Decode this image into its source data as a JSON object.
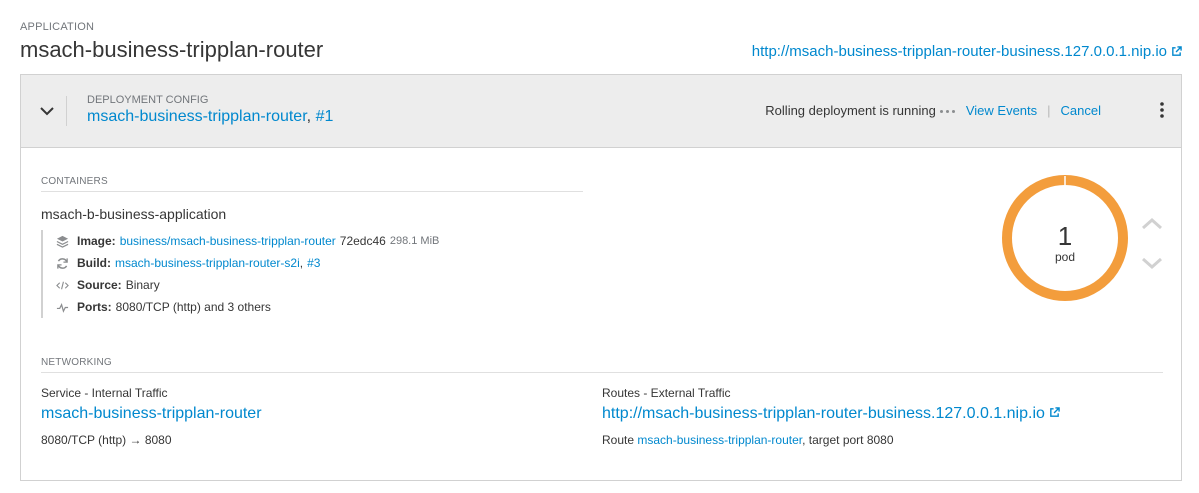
{
  "application": {
    "label": "APPLICATION",
    "name": "msach-business-tripplan-router",
    "route_url": "http://msach-business-tripplan-router-business.127.0.0.1.nip.io"
  },
  "deployment": {
    "label": "DEPLOYMENT CONFIG",
    "name": "msach-business-tripplan-router",
    "separator": ",",
    "revision": "#1",
    "status_text": "Rolling deployment is running",
    "view_events": "View Events",
    "divider": "|",
    "cancel": "Cancel"
  },
  "containers": {
    "label": "CONTAINERS",
    "name": "msach-b-business-application",
    "image": {
      "key": "Image:",
      "link": "business/msach-business-tripplan-router",
      "hash": "72edc46",
      "size": "298.1 MiB"
    },
    "build": {
      "key": "Build:",
      "link": "msach-business-tripplan-router-s2i",
      "separator": ",",
      "number": "#3"
    },
    "source": {
      "key": "Source:",
      "value": "Binary"
    },
    "ports": {
      "key": "Ports:",
      "value": "8080/TCP (http) and 3 others"
    }
  },
  "pods": {
    "count": "1",
    "unit": "pod",
    "ring_color": "#f39d3c"
  },
  "networking": {
    "label": "NETWORKING",
    "service": {
      "heading": "Service - Internal Traffic",
      "name": "msach-business-tripplan-router",
      "ports": "8080/TCP (http) → 8080"
    },
    "routes": {
      "heading": "Routes - External Traffic",
      "url": "http://msach-business-tripplan-router-business.127.0.0.1.nip.io",
      "prefix": "Route",
      "route_name": "msach-business-tripplan-router",
      "suffix": ", target port 8080"
    }
  },
  "colors": {
    "link": "#0088ce",
    "ring": "#f39d3c"
  },
  "icons": [
    "external-link-icon",
    "chevron-down-icon",
    "kebab-icon",
    "image-icon",
    "build-icon",
    "source-icon",
    "ports-icon",
    "scale-up-icon",
    "scale-down-icon"
  ]
}
